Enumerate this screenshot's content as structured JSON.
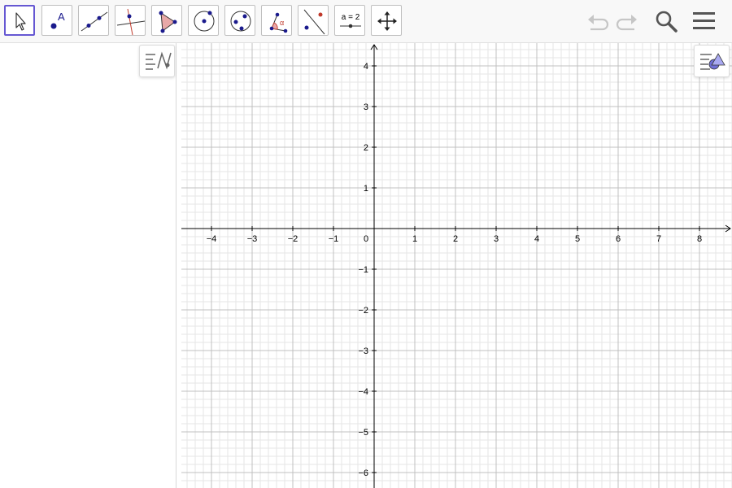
{
  "toolbar": {
    "tools": [
      {
        "name": "move",
        "icon": "cursor-arrow-icon",
        "selected": true
      },
      {
        "name": "point",
        "icon": "point-icon",
        "label": "A"
      },
      {
        "name": "line",
        "icon": "line-through-two-points-icon"
      },
      {
        "name": "perpendicular-line",
        "icon": "perpendicular-line-icon"
      },
      {
        "name": "polygon",
        "icon": "polygon-icon"
      },
      {
        "name": "circle",
        "icon": "circle-center-point-icon"
      },
      {
        "name": "circle-three-points",
        "icon": "circle-three-points-icon"
      },
      {
        "name": "angle",
        "icon": "angle-icon",
        "label": "α"
      },
      {
        "name": "reflect",
        "icon": "reflect-about-line-icon"
      },
      {
        "name": "slider",
        "icon": "slider-icon",
        "label": "a = 2"
      },
      {
        "name": "move-graphics-view",
        "icon": "move-graphics-view-icon"
      }
    ],
    "right_buttons": [
      "undo-icon",
      "redo-icon",
      "search-icon",
      "menu-icon"
    ]
  },
  "algebra_view": {
    "toggle_icon": "algebra-input-style-icon",
    "items": []
  },
  "graphics_view": {
    "style_bar_icon": "graphics-style-bar-icon",
    "axes": {
      "x_ticks": [
        "−4",
        "−3",
        "−2",
        "−1",
        "0",
        "1",
        "2",
        "3",
        "4",
        "5",
        "6",
        "7",
        "8"
      ],
      "y_ticks_positive": [
        "4",
        "3",
        "2",
        "1"
      ],
      "y_ticks_negative": [
        "−1",
        "−2",
        "−3",
        "−4",
        "−5",
        "−6"
      ],
      "x_range": [
        -4.7,
        8.8
      ],
      "y_range": [
        -6.3,
        4.6
      ],
      "grid": true,
      "minor_grid": true
    },
    "colors": {
      "accent": "#6557d2",
      "point": "#1a1a8c",
      "major_grid": "#c0c0c0",
      "minor_grid": "#e6e6e6",
      "axis": "#000000"
    }
  }
}
